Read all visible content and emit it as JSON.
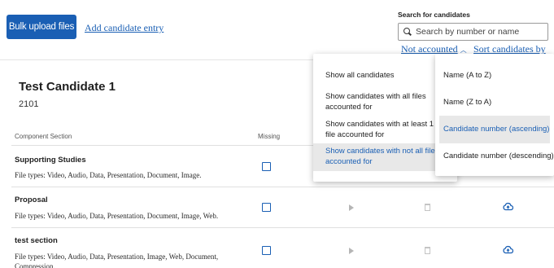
{
  "toolbar": {
    "bulk_upload_label": "Bulk upload files",
    "add_candidate_label": "Add candidate entry"
  },
  "search": {
    "label": "Search for candidates",
    "placeholder": "Search by number or name"
  },
  "filters": {
    "filter_label": "Not accounted",
    "sort_label": "Sort candidates by"
  },
  "candidate": {
    "name": "Test Candidate 1",
    "number": "2101"
  },
  "table": {
    "col_component": "Component Section",
    "col_missing": "Missing",
    "rows": [
      {
        "title": "Supporting Studies",
        "file_types": "File types: Video, Audio, Data, Presentation, Document, Image."
      },
      {
        "title": "Proposal",
        "file_types": "File types: Video, Audio, Data, Presentation, Document, Image, Web."
      },
      {
        "title": "test section",
        "file_types": "File types: Video, Audio, Data, Presentation, Image, Web, Document, Compression."
      }
    ]
  },
  "filter_menu": {
    "items": [
      "Show all candidates",
      "Show candidates with all files accounted for",
      "Show candidates with at least 1 file accounted for",
      "Show candidates with not all files accounted for"
    ],
    "selected_index": 3
  },
  "sort_menu": {
    "items": [
      "Name (A to Z)",
      "Name (Z to A)",
      "Candidate number (ascending)",
      "Candidate number (descending)"
    ],
    "selected_index": 2
  },
  "colors": {
    "accent": "#1a5fb4",
    "selected_bg": "#e8e8e8"
  },
  "icons": {
    "search": "search-icon",
    "caret": "chevron-up-icon",
    "checkbox": "checkbox-icon",
    "play": "play-icon",
    "trash": "trash-icon",
    "upload": "cloud-upload-icon",
    "check": "check-icon"
  }
}
